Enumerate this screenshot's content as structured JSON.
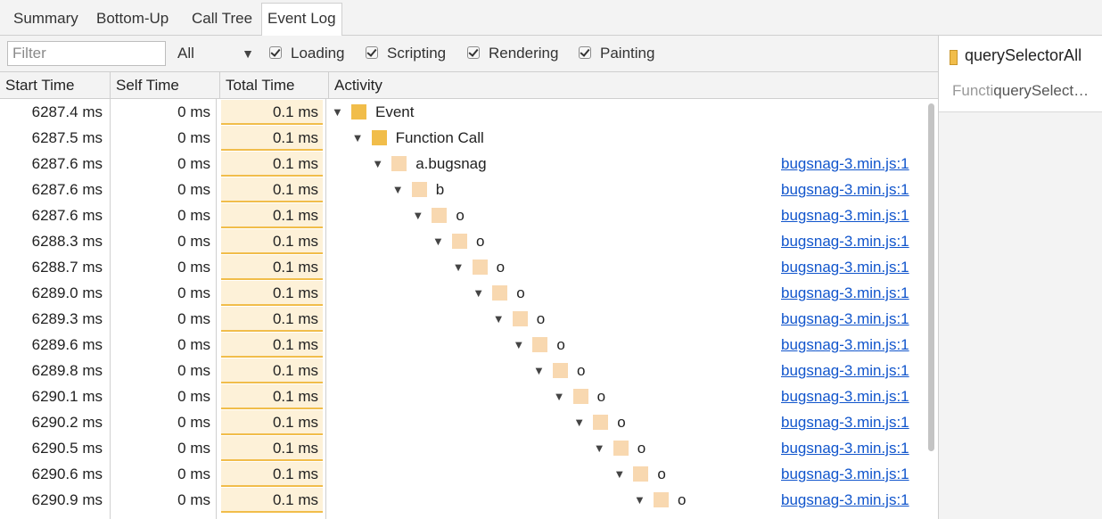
{
  "tabs": [
    {
      "label": "Summary",
      "active": false
    },
    {
      "label": "Bottom-Up",
      "active": false
    },
    {
      "label": "Call Tree",
      "active": false
    },
    {
      "label": "Event Log",
      "active": true
    }
  ],
  "toolbar": {
    "filter_placeholder": "Filter",
    "select_value": "All",
    "checkboxes": [
      {
        "label": "Loading",
        "checked": true
      },
      {
        "label": "Scripting",
        "checked": true
      },
      {
        "label": "Rendering",
        "checked": true
      },
      {
        "label": "Painting",
        "checked": true
      }
    ]
  },
  "columns": [
    "Start Time",
    "Self Time",
    "Total Time",
    "Activity"
  ],
  "colors": {
    "event_swatch": "#f1bd4a",
    "function_swatch": "#f8d8b0",
    "link": "#1155cc"
  },
  "rows": [
    {
      "start": "6287.4 ms",
      "self": "0 ms",
      "total": "0.1 ms",
      "activity": "Event",
      "source": ""
    },
    {
      "start": "6287.5 ms",
      "self": "0 ms",
      "total": "0.1 ms",
      "activity": "Function Call",
      "source": ""
    },
    {
      "start": "6287.6 ms",
      "self": "0 ms",
      "total": "0.1 ms",
      "activity": "a.bugsnag",
      "source": "bugsnag-3.min.js:1"
    },
    {
      "start": "6287.6 ms",
      "self": "0 ms",
      "total": "0.1 ms",
      "activity": "b",
      "source": "bugsnag-3.min.js:1"
    },
    {
      "start": "6287.6 ms",
      "self": "0 ms",
      "total": "0.1 ms",
      "activity": "o",
      "source": "bugsnag-3.min.js:1"
    },
    {
      "start": "6288.3 ms",
      "self": "0 ms",
      "total": "0.1 ms",
      "activity": "o",
      "source": "bugsnag-3.min.js:1"
    },
    {
      "start": "6288.7 ms",
      "self": "0 ms",
      "total": "0.1 ms",
      "activity": "o",
      "source": "bugsnag-3.min.js:1"
    },
    {
      "start": "6289.0 ms",
      "self": "0 ms",
      "total": "0.1 ms",
      "activity": "o",
      "source": "bugsnag-3.min.js:1"
    },
    {
      "start": "6289.3 ms",
      "self": "0 ms",
      "total": "0.1 ms",
      "activity": "o",
      "source": "bugsnag-3.min.js:1"
    },
    {
      "start": "6289.6 ms",
      "self": "0 ms",
      "total": "0.1 ms",
      "activity": "o",
      "source": "bugsnag-3.min.js:1"
    },
    {
      "start": "6289.8 ms",
      "self": "0 ms",
      "total": "0.1 ms",
      "activity": "o",
      "source": "bugsnag-3.min.js:1"
    },
    {
      "start": "6290.1 ms",
      "self": "0 ms",
      "total": "0.1 ms",
      "activity": "o",
      "source": "bugsnag-3.min.js:1"
    },
    {
      "start": "6290.2 ms",
      "self": "0 ms",
      "total": "0.1 ms",
      "activity": "o",
      "source": "bugsnag-3.min.js:1"
    },
    {
      "start": "6290.5 ms",
      "self": "0 ms",
      "total": "0.1 ms",
      "activity": "o",
      "source": "bugsnag-3.min.js:1"
    },
    {
      "start": "6290.6 ms",
      "self": "0 ms",
      "total": "0.1 ms",
      "activity": "o",
      "source": "bugsnag-3.min.js:1"
    },
    {
      "start": "6290.9 ms",
      "self": "0 ms",
      "total": "0.1 ms",
      "activity": "o",
      "source": "bugsnag-3.min.js:1"
    }
  ],
  "details": {
    "title": "querySelectorAll",
    "subtitle_prefix": "Functi",
    "subtitle": "querySelect…"
  }
}
